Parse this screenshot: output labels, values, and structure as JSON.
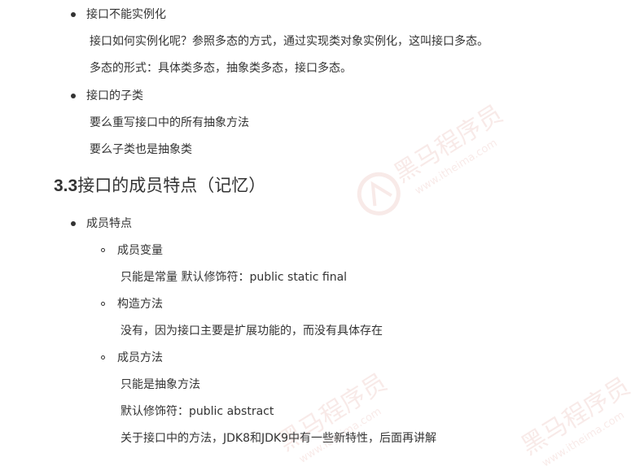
{
  "section_a": {
    "bullet1_title": "接口不能实例化",
    "bullet1_line1": "接口如何实例化呢？参照多态的方式，通过实现类对象实例化，这叫接口多态。",
    "bullet1_line2": "多态的形式：具体类多态，抽象类多态，接口多态。",
    "bullet2_title": "接口的子类",
    "bullet2_line1": "要么重写接口中的所有抽象方法",
    "bullet2_line2": "要么子类也是抽象类"
  },
  "heading": {
    "number": "3.3",
    "text": "接口的成员特点（记忆）"
  },
  "section_b": {
    "bullet_title": "成员特点",
    "items": [
      {
        "title": "成员变量",
        "lines": [
          "只能是常量 默认修饰符：public static final"
        ]
      },
      {
        "title": "构造方法",
        "lines": [
          "没有，因为接口主要是扩展功能的，而没有具体存在"
        ]
      },
      {
        "title": "成员方法",
        "lines": [
          "只能是抽象方法",
          "默认修饰符：public abstract",
          "关于接口中的方法，JDK8和JDK9中有一些新特性，后面再讲解"
        ]
      }
    ]
  },
  "watermark": {
    "brand": "黑马程序员",
    "url": "www.itheima.com",
    "color": "#c0392b"
  }
}
